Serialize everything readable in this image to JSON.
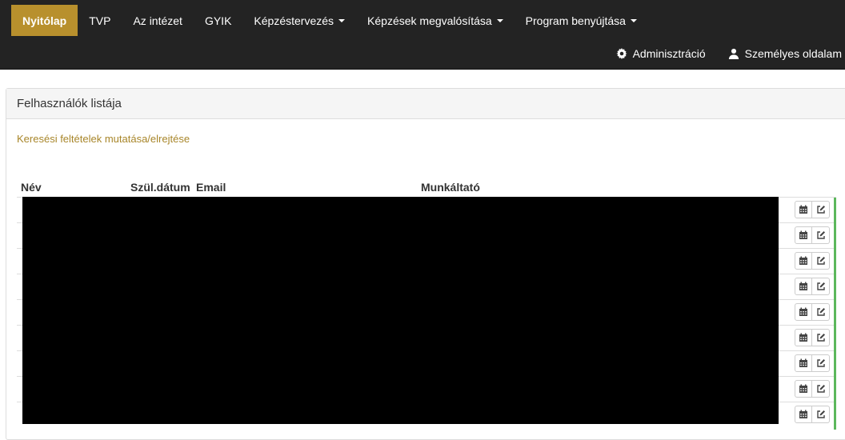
{
  "nav": {
    "items": [
      {
        "label": "Nyitólap",
        "active": true,
        "dropdown": false
      },
      {
        "label": "TVP",
        "active": false,
        "dropdown": false
      },
      {
        "label": "Az intézet",
        "active": false,
        "dropdown": false
      },
      {
        "label": "GYIK",
        "active": false,
        "dropdown": false
      },
      {
        "label": "Képzéstervezés",
        "active": false,
        "dropdown": true
      },
      {
        "label": "Képzések megvalósítása",
        "active": false,
        "dropdown": true
      },
      {
        "label": "Program benyújtása",
        "active": false,
        "dropdown": true
      }
    ],
    "admin_label": "Adminisztráció",
    "admin_icon": "gear-icon",
    "profile_label": "Személyes oldalam",
    "profile_icon": "user-icon"
  },
  "panel": {
    "title": "Felhasználók listája",
    "toggle_link": "Keresési feltételek mutatása/elrejtése"
  },
  "table": {
    "columns": [
      "Név",
      "Szül.dátum",
      "Email",
      "Munkáltató"
    ],
    "row_count": 9,
    "row_actions": [
      "calendar-icon",
      "edit-icon"
    ]
  },
  "colors": {
    "navbar_bg": "#232323",
    "active_nav": "#b8902d",
    "link": "#a8862a",
    "row_marker": "#5cb85c"
  }
}
